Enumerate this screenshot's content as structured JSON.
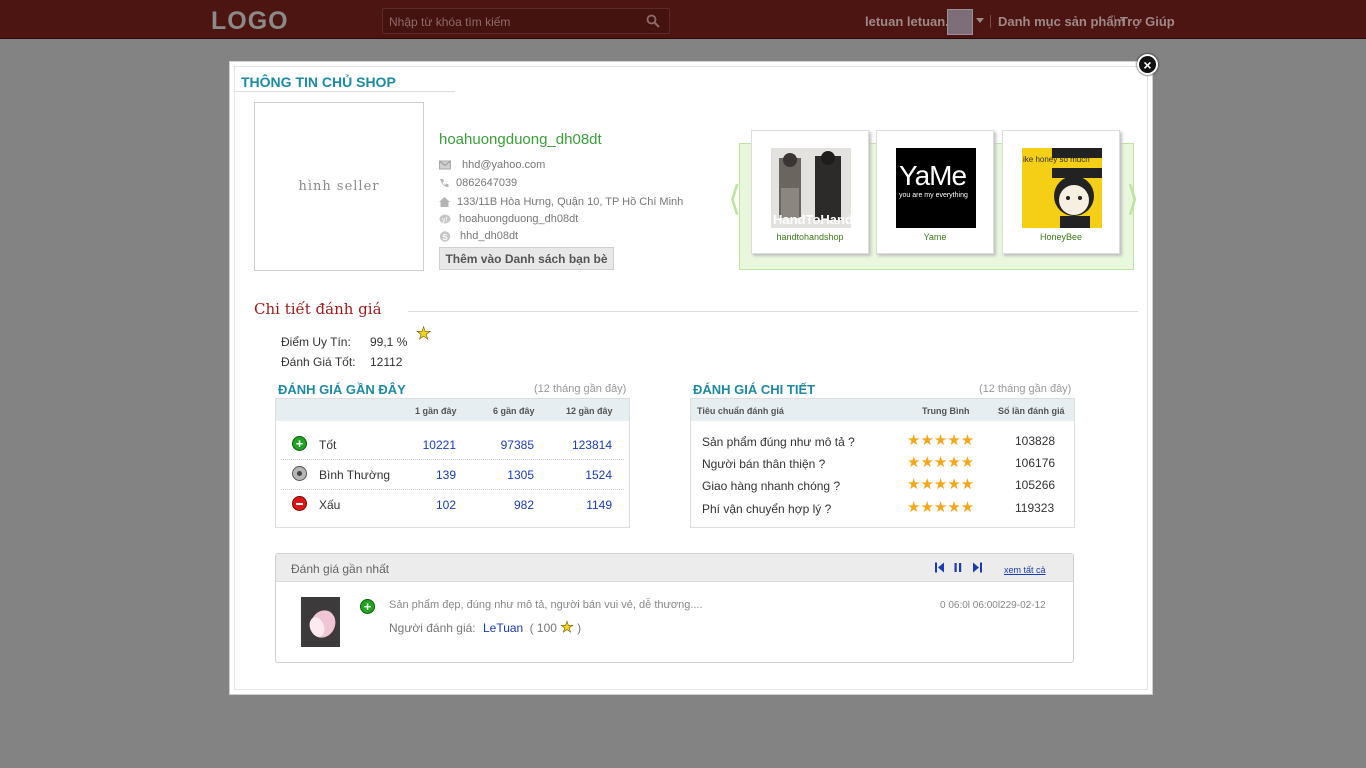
{
  "header": {
    "logo": "LOGO",
    "search_placeholder": "Nhập từ khóa tìm kiếm",
    "user_name": "letuan letuan...",
    "nav_products": "Danh mục sản phẩm",
    "nav_help": "Trợ Giúp"
  },
  "modal": {
    "title": "THÔNG TIN CHỦ  SHOP",
    "close_label": "×",
    "seller_image_label": "hình seller",
    "shop_name": "hoahuongduong_dh08dt",
    "email": "hhd@yahoo.com",
    "phone": "0862647039",
    "address": "133/11B Hòa Hưng,  Quận 10,  TP Hồ Chí Minh",
    "yahoo": "hoahuongduong_dh08dt",
    "skype": "hhd_dh08dt",
    "add_friend_label": "Thêm vào Danh sách bạn bè",
    "brands": [
      {
        "name": "handtohandshop",
        "logo_text": "HandToHand"
      },
      {
        "name": "Yame",
        "logo_text": "YaMe",
        "tagline": "you are my everything"
      },
      {
        "name": "HoneyBee",
        "logo_text": "ike honey so much"
      }
    ]
  },
  "rating": {
    "section_title": "Chi tiết đánh giá",
    "reputation_label": "Điểm Uy Tín:",
    "reputation_value": "99,1 %",
    "good_label": "Đánh Giá Tốt:",
    "good_value": "12112"
  },
  "recent": {
    "title": "ĐÁNH GIÁ GẦN ĐÂY",
    "subtitle": "(12 tháng gần đây)",
    "columns": [
      "1 gần đây",
      "6 gần đây",
      "12 gần đây"
    ],
    "rows": [
      {
        "label": "Tốt",
        "type": "good",
        "values": [
          "10221",
          "97385",
          "123814"
        ]
      },
      {
        "label": "Bình Thường",
        "type": "neutral",
        "values": [
          "139",
          "1305",
          "1524"
        ]
      },
      {
        "label": "Xấu",
        "type": "bad",
        "values": [
          "102",
          "982",
          "1149"
        ]
      }
    ]
  },
  "detail": {
    "title": "ĐÁNH GIÁ CHI TIẾT",
    "subtitle": "(12 tháng gần đây)",
    "columns": [
      "Tiêu chuẩn đánh giá",
      "Trung Bình",
      "Số lần đánh giá"
    ],
    "rows": [
      {
        "criterion": "Sản phẩm đúng như mô tả ?",
        "stars": 5,
        "count": "103828"
      },
      {
        "criterion": "Người bán thân thiện ?",
        "stars": 5,
        "count": "106176"
      },
      {
        "criterion": "Giao hàng nhanh chóng ?",
        "stars": 5,
        "count": "105266"
      },
      {
        "criterion": "Phí vận chuyển hợp lý ?",
        "stars": 5,
        "count": "119323"
      }
    ]
  },
  "latest": {
    "title": "Đánh giá gần nhất",
    "see_all": "xem tất cả",
    "text": "Sản phẩm đẹp, đúng như mô tả, người bán vui vẻ, dễ thương....",
    "reviewer_label": "Người đánh giá:",
    "reviewer_name": "LeTuan",
    "reviewer_score_prefix": "( 100",
    "reviewer_score_suffix": ")",
    "date": "0 06:0l 06:00l229-02-12"
  },
  "colors": {
    "topbar": "#4c1512",
    "accent_teal": "#1d8aa0",
    "shop_green": "#3b9e3b",
    "section_red": "#9b1b1b",
    "link_blue": "#1a3cb0",
    "star_orange": "#f3a71c"
  }
}
